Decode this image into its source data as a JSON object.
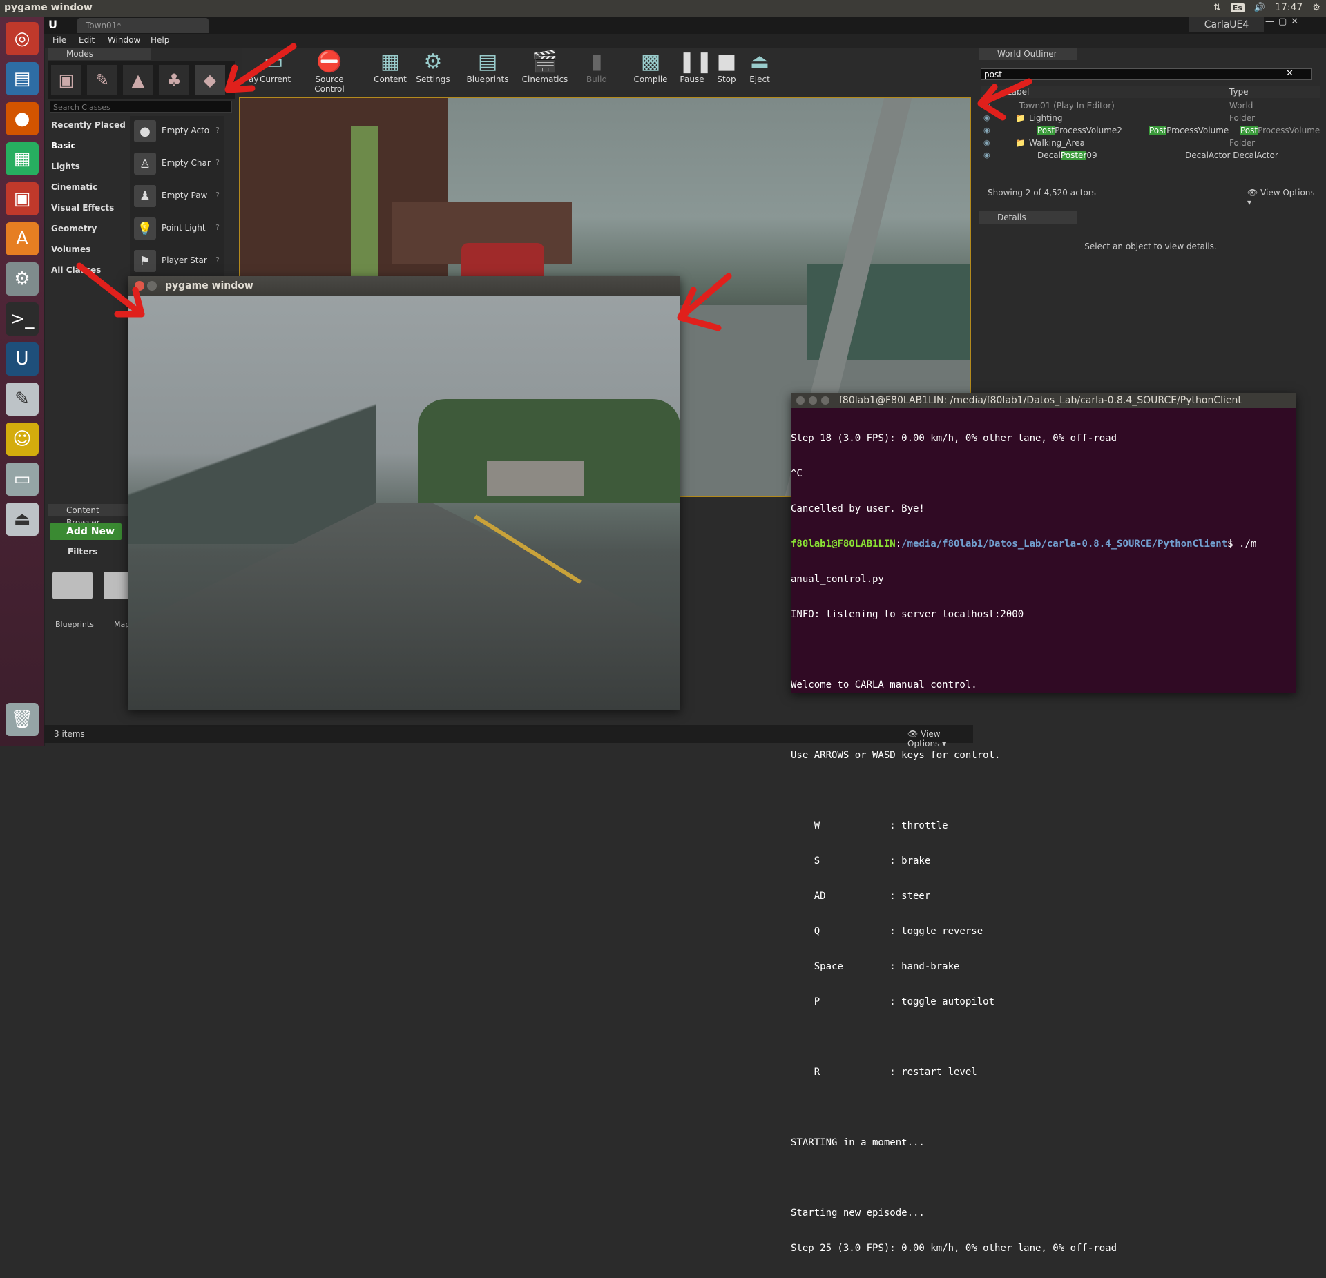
{
  "top_panel": {
    "title": "pygame window",
    "keyboard_layout": "Es",
    "time": "17:47"
  },
  "launcher": {
    "icons": [
      "ubuntu-dash-icon",
      "text-editor-doc-icon",
      "firefox-icon",
      "spreadsheet-icon",
      "presentation-icon",
      "software-center-icon",
      "system-settings-icon",
      "terminal-icon",
      "unreal-engine-icon",
      "text-editor-icon",
      "game-icon",
      "drive-icon",
      "usb-drive-icon",
      "trash-icon"
    ]
  },
  "editor": {
    "tab": "Town01*",
    "project": "CarlaUE4",
    "menu": [
      "File",
      "Edit",
      "Window",
      "Help"
    ]
  },
  "modes": {
    "tab": "Modes",
    "search_placeholder": "Search Classes",
    "categories": [
      "Recently Placed",
      "Basic",
      "Lights",
      "Cinematic",
      "Visual Effects",
      "Geometry",
      "Volumes",
      "All Classes"
    ],
    "entries": [
      {
        "label": "Empty Acto"
      },
      {
        "label": "Empty Char"
      },
      {
        "label": "Empty Paw"
      },
      {
        "label": "Point Light"
      },
      {
        "label": "Player Star"
      }
    ]
  },
  "toolbar": {
    "buttons": [
      "Current",
      "Source Control",
      "Content",
      "Settings",
      "Blueprints",
      "Cinematics",
      "Build",
      "Compile",
      "Pause",
      "Stop",
      "Eject"
    ],
    "partial": "ay"
  },
  "content_browser": {
    "tab": "Content Browser",
    "add_new": "Add New",
    "filters": "Filters",
    "folders": [
      "Blueprints",
      "Map"
    ],
    "items_count": "3 items",
    "view_options": "View Options"
  },
  "world_outliner": {
    "tab": "World Outliner",
    "search_value": "post",
    "col_label": "Label",
    "col_type": "Type",
    "rows": [
      {
        "pre": "",
        "hl": "",
        "post": "Town01 (Play In Editor)",
        "type": "World",
        "type_hl": "",
        "type_post": ""
      },
      {
        "pre": "",
        "hl": "",
        "post": "Lighting",
        "type": "Folder",
        "type_hl": "",
        "type_post": ""
      },
      {
        "pre": "",
        "hl": "Post",
        "post": "ProcessVolume2",
        "type": "ProcessVolume",
        "type_pre": "Post",
        "type_hl": "Post",
        "type_post": "ProcessVolume"
      },
      {
        "pre": "",
        "hl": "",
        "post": "Walking_Area",
        "type": "Folder",
        "type_hl": "",
        "type_post": ""
      },
      {
        "pre": "Decal",
        "hl": "Poster",
        "post": "09",
        "type": "DecalActor DecalActor",
        "type_hl": "",
        "type_post": ""
      }
    ],
    "footer": "Showing 2 of 4,520 actors",
    "view_options": "View Options"
  },
  "details": {
    "tab": "Details",
    "empty_message": "Select an object to view details."
  },
  "pygame": {
    "title": "pygame window"
  },
  "terminal": {
    "title": "f80lab1@F80LAB1LIN: /media/f80lab1/Datos_Lab/carla-0.8.4_SOURCE/PythonClient",
    "lines_before": [
      "Step 18 (3.0 FPS): 0.00 km/h, 0% other lane, 0% off-road",
      "^C",
      "Cancelled by user. Bye!"
    ],
    "prompt_user": "f80lab1@F80LAB1LIN",
    "prompt_sep": ":",
    "prompt_path": "/media/f80lab1/Datos_Lab/carla-0.8.4_SOURCE/PythonClient",
    "prompt_cmd": "$ ./m",
    "lines_after": [
      "anual_control.py",
      "INFO: listening to server localhost:2000",
      "",
      "Welcome to CARLA manual control.",
      "",
      "Use ARROWS or WASD keys for control.",
      "",
      "    W            : throttle",
      "    S            : brake",
      "    AD           : steer",
      "    Q            : toggle reverse",
      "    Space        : hand-brake",
      "    P            : toggle autopilot",
      "",
      "    R            : restart level",
      "",
      "STARTING in a moment...",
      "",
      "Starting new episode...",
      "Step 25 (3.0 FPS): 0.00 km/h, 0% other lane, 0% off-road"
    ]
  },
  "colors": {
    "launcher": "#5a2a3e",
    "terminal_bg": "#300a24",
    "highlight": "#3a9a3a",
    "arrow": "#e0201c"
  }
}
